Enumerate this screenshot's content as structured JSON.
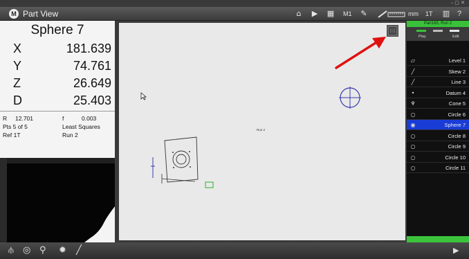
{
  "app": {
    "title": "Part View",
    "logo": "M"
  },
  "toolbar": {
    "icons": [
      "home-icon",
      "video-icon",
      "grid-icon",
      "wand-icon",
      "ruler-icon",
      "columns-icon",
      "help-icon"
    ],
    "m1_label": "M1",
    "units_label": "mm",
    "ref_label": "1T",
    "help_label": "?"
  },
  "dro": {
    "feature": "Sphere 7",
    "rows": [
      {
        "axis": "X",
        "value": "181.639"
      },
      {
        "axis": "Y",
        "value": "74.761"
      },
      {
        "axis": "Z",
        "value": "26.649"
      },
      {
        "axis": "D",
        "value": "25.403"
      }
    ],
    "r_label": "R",
    "r_value": "12.701",
    "f_label": "f",
    "f_value": "0.003",
    "pts": "Pts 5 of 5",
    "method": "Least Squares",
    "ref": "Ref 1T",
    "run": "Run 2"
  },
  "canvas": {
    "run_label": "Run 2"
  },
  "feature_list": {
    "header": "Part165, Run 2",
    "tabs": [
      "Play",
      "Edit"
    ],
    "items": [
      {
        "icon": "plane-icon",
        "glyph": "▱",
        "label": "Level 1",
        "selected": false
      },
      {
        "icon": "line-icon",
        "glyph": "╱",
        "label": "Skew 2",
        "selected": false
      },
      {
        "icon": "line-icon",
        "glyph": "╱",
        "label": "Line 3",
        "selected": false
      },
      {
        "icon": "point-icon",
        "glyph": "•",
        "label": "Datum 4",
        "selected": false
      },
      {
        "icon": "cone-icon",
        "glyph": "♆",
        "label": "Cone 5",
        "selected": false
      },
      {
        "icon": "circle-icon",
        "glyph": "○",
        "label": "Circle 6",
        "selected": false
      },
      {
        "icon": "sphere-icon",
        "glyph": "◉",
        "label": "Sphere 7",
        "selected": true
      },
      {
        "icon": "circle-icon",
        "glyph": "○",
        "label": "Circle 8",
        "selected": false
      },
      {
        "icon": "circle-icon",
        "glyph": "○",
        "label": "Circle 9",
        "selected": false
      },
      {
        "icon": "circle-icon",
        "glyph": "○",
        "label": "Circle 10",
        "selected": false
      },
      {
        "icon": "circle-icon",
        "glyph": "○",
        "label": "Circle 11",
        "selected": false
      }
    ]
  },
  "bottom": {
    "icons": [
      "probe-icon",
      "target-icon",
      "zoom-icon",
      "light-icon",
      "pen-icon",
      "play-icon"
    ]
  },
  "colors": {
    "accent_green": "#3bc43b",
    "selected_blue": "#1a3cd6",
    "annotation_red": "#e01010",
    "sphere_blue": "#3a3ab0"
  }
}
